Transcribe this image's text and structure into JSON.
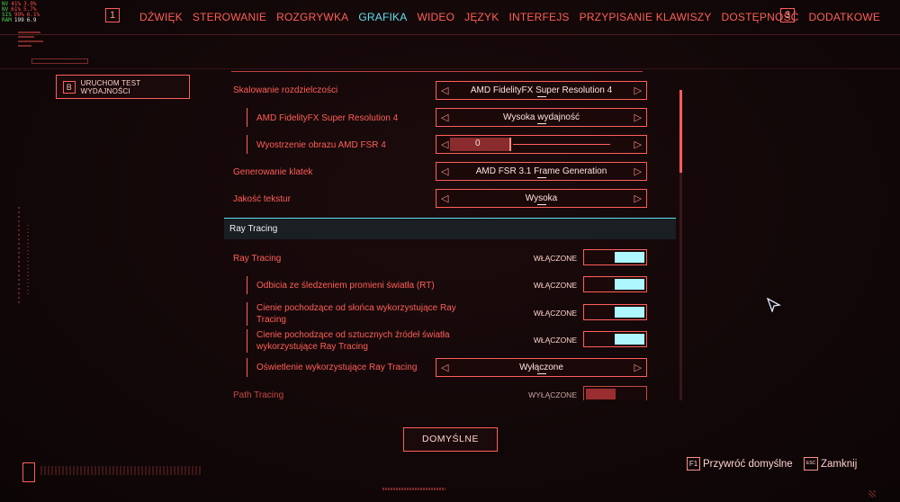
{
  "hud": {
    "rows": [
      [
        "NV",
        "41%",
        "3.9%"
      ],
      [
        "NV",
        "61%",
        "5.7%"
      ],
      [
        "SIS",
        "99%",
        "6.1%"
      ],
      [
        "RAM",
        "199",
        "6.9"
      ]
    ]
  },
  "nav": {
    "left_key": "1",
    "right_key": "3",
    "tabs": [
      "DŹWIĘK",
      "STEROWANIE",
      "ROZGRYWKA",
      "GRAFIKA",
      "WIDEO",
      "JĘZYK",
      "INTERFEJS",
      "PRZYPISANIE KLAWISZY",
      "DOSTĘPNOŚĆ",
      "DODATKOWE"
    ],
    "active_tab": "GRAFIKA"
  },
  "benchmark": {
    "key": "B",
    "label": "URUCHOM TEST WYDAJNOŚCI"
  },
  "settings": {
    "resolution_scaling": {
      "label": "Skalowanie rozdzielczości",
      "value": "AMD FidelityFX Super Resolution 4"
    },
    "fsr4": {
      "label": "AMD FidelityFX Super Resolution 4",
      "value": "Wysoka wydajność"
    },
    "sharpening": {
      "label": "Wyostrzenie obrazu AMD FSR 4",
      "value": "0",
      "level": 0
    },
    "frame_gen": {
      "label": "Generowanie klatek",
      "value": "AMD FSR 3.1 Frame Generation"
    },
    "texture_quality": {
      "label": "Jakość tekstur",
      "value": "Wysoka"
    },
    "section_title": "Ray Tracing",
    "ray_tracing": {
      "label": "Ray Tracing",
      "state": "WŁĄCZONE"
    },
    "rt_reflections": {
      "label": "Odbicia ze śledzeniem promieni światła (RT)",
      "state": "WŁĄCZONE"
    },
    "rt_sun_shadows": {
      "label": "Cienie pochodzące od słońca wykorzystujące Ray Tracing",
      "state": "WŁĄCZONE"
    },
    "rt_local_shadows": {
      "label": "Cienie pochodzące od sztucznych źródeł światła wykorzystujące Ray Tracing",
      "state": "WŁĄCZONE"
    },
    "rt_lighting": {
      "label": "Oświetlenie wykorzystujące Ray Tracing",
      "value": "Wyłączone"
    },
    "path_tracing": {
      "label": "Path Tracing",
      "state": "WYŁĄCZONE"
    }
  },
  "buttons": {
    "defaults": "DOMYŚLNE",
    "restore_key": "F1",
    "restore_label": "Przywróć domyślne",
    "close_key": "ESC",
    "close_label": "Zamknij"
  },
  "colors": {
    "accent_red": "#ff5f57",
    "accent_cyan": "#5ee0ee",
    "toggle_on": "#aef7ff",
    "toggle_off": "#c73a3c",
    "background": "#120708"
  },
  "icons": {
    "left_arrow": "left-triangle-icon",
    "right_arrow": "right-triangle-icon",
    "cursor": "mouse-cursor-icon"
  }
}
